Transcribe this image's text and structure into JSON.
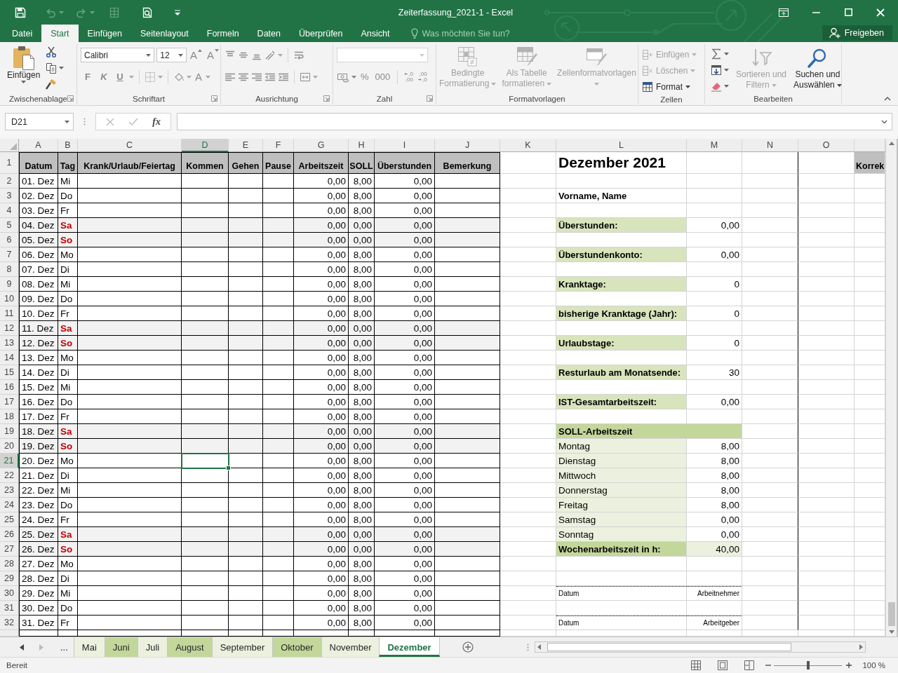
{
  "window": {
    "title": "Zeiterfassung_2021-1 - Excel"
  },
  "ribbon_tabs": [
    {
      "label": "Datei",
      "selected": false
    },
    {
      "label": "Start",
      "selected": true
    },
    {
      "label": "Einfügen",
      "selected": false
    },
    {
      "label": "Seitenlayout",
      "selected": false
    },
    {
      "label": "Formeln",
      "selected": false
    },
    {
      "label": "Daten",
      "selected": false
    },
    {
      "label": "Überprüfen",
      "selected": false
    },
    {
      "label": "Ansicht",
      "selected": false
    }
  ],
  "tell_me": {
    "placeholder": "Was möchten Sie tun?"
  },
  "share_button": "Freigeben",
  "ribbon": {
    "clipboard": {
      "title": "Zwischenablage",
      "paste": "Einfügen"
    },
    "font": {
      "title": "Schriftart",
      "family": "Calibri",
      "size": "12",
      "grow_letter": "A",
      "shrink_letter": "A",
      "bold": "F",
      "italic": "K",
      "underline": "U",
      "color_letter": "A"
    },
    "alignment": {
      "title": "Ausrichtung"
    },
    "number": {
      "title": "Zahl",
      "percent": "%",
      "thousands": "000",
      "increase_decimal": [
        ",0",
        ",00"
      ],
      "decrease_decimal": [
        ",00",
        ",0"
      ]
    },
    "styles": {
      "title": "Formatvorlagen",
      "items": [
        {
          "kind": "conditional",
          "lines": [
            "Bedingte",
            "Formatierung"
          ],
          "disabled": true
        },
        {
          "kind": "table",
          "lines": [
            "Als Tabelle",
            "formatieren"
          ],
          "disabled": true
        },
        {
          "kind": "styles",
          "lines": [
            "Zellenformatvorlagen"
          ],
          "disabled": true
        }
      ]
    },
    "cells": {
      "title": "Zellen",
      "items": [
        {
          "kind": "insert",
          "label": "Einfügen",
          "disabled": true
        },
        {
          "kind": "delete",
          "label": "Löschen",
          "disabled": true
        },
        {
          "kind": "format",
          "label": "Format",
          "disabled": false
        }
      ]
    },
    "editing": {
      "title": "Bearbeiten",
      "items": [
        {
          "kind": "sort",
          "lines": [
            "Sortieren und",
            "Filtern"
          ],
          "disabled": true
        },
        {
          "kind": "find",
          "lines": [
            "Suchen und",
            "Auswählen"
          ],
          "disabled": false
        }
      ]
    }
  },
  "formula_bar": {
    "name_box": "D21",
    "function_label": "fx"
  },
  "sheet": {
    "columns": [
      {
        "label": "A",
        "selected": false
      },
      {
        "label": "B",
        "selected": false
      },
      {
        "label": "C",
        "selected": false
      },
      {
        "label": "D",
        "selected": true
      },
      {
        "label": "E",
        "selected": false
      },
      {
        "label": "F",
        "selected": false
      },
      {
        "label": "G",
        "selected": false
      },
      {
        "label": "H",
        "selected": false
      },
      {
        "label": "I",
        "selected": false
      },
      {
        "label": "J",
        "selected": false
      },
      {
        "label": "K",
        "selected": false
      },
      {
        "label": "L",
        "selected": false
      },
      {
        "label": "M",
        "selected": false
      },
      {
        "label": "N",
        "selected": false
      },
      {
        "label": "O",
        "selected": false
      }
    ],
    "row_numbers": [
      {
        "label": "1",
        "selected": false
      },
      {
        "label": "2",
        "selected": false
      },
      {
        "label": "3",
        "selected": false
      },
      {
        "label": "4",
        "selected": false
      },
      {
        "label": "5",
        "selected": false
      },
      {
        "label": "6",
        "selected": false
      },
      {
        "label": "7",
        "selected": false
      },
      {
        "label": "8",
        "selected": false
      },
      {
        "label": "9",
        "selected": false
      },
      {
        "label": "10",
        "selected": false
      },
      {
        "label": "11",
        "selected": false
      },
      {
        "label": "12",
        "selected": false
      },
      {
        "label": "13",
        "selected": false
      },
      {
        "label": "14",
        "selected": false
      },
      {
        "label": "15",
        "selected": false
      },
      {
        "label": "16",
        "selected": false
      },
      {
        "label": "17",
        "selected": false
      },
      {
        "label": "18",
        "selected": false
      },
      {
        "label": "19",
        "selected": false
      },
      {
        "label": "20",
        "selected": false
      },
      {
        "label": "21",
        "selected": true
      },
      {
        "label": "22",
        "selected": false
      },
      {
        "label": "23",
        "selected": false
      },
      {
        "label": "24",
        "selected": false
      },
      {
        "label": "25",
        "selected": false
      },
      {
        "label": "26",
        "selected": false
      },
      {
        "label": "27",
        "selected": false
      },
      {
        "label": "28",
        "selected": false
      },
      {
        "label": "29",
        "selected": false
      },
      {
        "label": "30",
        "selected": false
      },
      {
        "label": "31",
        "selected": false
      },
      {
        "label": "32",
        "selected": false
      }
    ]
  },
  "table": {
    "columns": [
      "Datum",
      "Tag",
      "Krank/Urlaub/Feiertag",
      "Kommen",
      "Gehen",
      "Pause",
      "Arbeitszeit",
      "SOLL",
      "Überstunden",
      "Bemerkung"
    ],
    "rows": [
      {
        "date": "01. Dez",
        "day": "Mi",
        "weekend": false,
        "work": "0,00",
        "target": "8,00",
        "overtime": "0,00"
      },
      {
        "date": "02. Dez",
        "day": "Do",
        "weekend": false,
        "work": "0,00",
        "target": "8,00",
        "overtime": "0,00"
      },
      {
        "date": "03. Dez",
        "day": "Fr",
        "weekend": false,
        "work": "0,00",
        "target": "8,00",
        "overtime": "0,00"
      },
      {
        "date": "04. Dez",
        "day": "Sa",
        "weekend": true,
        "work": "0,00",
        "target": "0,00",
        "overtime": "0,00"
      },
      {
        "date": "05. Dez",
        "day": "So",
        "weekend": true,
        "work": "0,00",
        "target": "0,00",
        "overtime": "0,00"
      },
      {
        "date": "06. Dez",
        "day": "Mo",
        "weekend": false,
        "work": "0,00",
        "target": "8,00",
        "overtime": "0,00"
      },
      {
        "date": "07. Dez",
        "day": "Di",
        "weekend": false,
        "work": "0,00",
        "target": "8,00",
        "overtime": "0,00"
      },
      {
        "date": "08. Dez",
        "day": "Mi",
        "weekend": false,
        "work": "0,00",
        "target": "8,00",
        "overtime": "0,00"
      },
      {
        "date": "09. Dez",
        "day": "Do",
        "weekend": false,
        "work": "0,00",
        "target": "8,00",
        "overtime": "0,00"
      },
      {
        "date": "10. Dez",
        "day": "Fr",
        "weekend": false,
        "work": "0,00",
        "target": "8,00",
        "overtime": "0,00"
      },
      {
        "date": "11. Dez",
        "day": "Sa",
        "weekend": true,
        "work": "0,00",
        "target": "0,00",
        "overtime": "0,00"
      },
      {
        "date": "12. Dez",
        "day": "So",
        "weekend": true,
        "work": "0,00",
        "target": "0,00",
        "overtime": "0,00"
      },
      {
        "date": "13. Dez",
        "day": "Mo",
        "weekend": false,
        "work": "0,00",
        "target": "8,00",
        "overtime": "0,00"
      },
      {
        "date": "14. Dez",
        "day": "Di",
        "weekend": false,
        "work": "0,00",
        "target": "8,00",
        "overtime": "0,00"
      },
      {
        "date": "15. Dez",
        "day": "Mi",
        "weekend": false,
        "work": "0,00",
        "target": "8,00",
        "overtime": "0,00"
      },
      {
        "date": "16. Dez",
        "day": "Do",
        "weekend": false,
        "work": "0,00",
        "target": "8,00",
        "overtime": "0,00"
      },
      {
        "date": "17. Dez",
        "day": "Fr",
        "weekend": false,
        "work": "0,00",
        "target": "8,00",
        "overtime": "0,00"
      },
      {
        "date": "18. Dez",
        "day": "Sa",
        "weekend": true,
        "work": "0,00",
        "target": "0,00",
        "overtime": "0,00"
      },
      {
        "date": "19. Dez",
        "day": "So",
        "weekend": true,
        "work": "0,00",
        "target": "0,00",
        "overtime": "0,00"
      },
      {
        "date": "20. Dez",
        "day": "Mo",
        "weekend": false,
        "work": "0,00",
        "target": "8,00",
        "overtime": "0,00"
      },
      {
        "date": "21. Dez",
        "day": "Di",
        "weekend": false,
        "work": "0,00",
        "target": "8,00",
        "overtime": "0,00"
      },
      {
        "date": "22. Dez",
        "day": "Mi",
        "weekend": false,
        "work": "0,00",
        "target": "8,00",
        "overtime": "0,00"
      },
      {
        "date": "23. Dez",
        "day": "Do",
        "weekend": false,
        "work": "0,00",
        "target": "8,00",
        "overtime": "0,00"
      },
      {
        "date": "24. Dez",
        "day": "Fr",
        "weekend": false,
        "work": "0,00",
        "target": "8,00",
        "overtime": "0,00"
      },
      {
        "date": "25. Dez",
        "day": "Sa",
        "weekend": true,
        "work": "0,00",
        "target": "0,00",
        "overtime": "0,00"
      },
      {
        "date": "26. Dez",
        "day": "So",
        "weekend": true,
        "work": "0,00",
        "target": "0,00",
        "overtime": "0,00"
      },
      {
        "date": "27. Dez",
        "day": "Mo",
        "weekend": false,
        "work": "0,00",
        "target": "8,00",
        "overtime": "0,00"
      },
      {
        "date": "28. Dez",
        "day": "Di",
        "weekend": false,
        "work": "0,00",
        "target": "8,00",
        "overtime": "0,00"
      },
      {
        "date": "29. Dez",
        "day": "Mi",
        "weekend": false,
        "work": "0,00",
        "target": "8,00",
        "overtime": "0,00"
      },
      {
        "date": "30. Dez",
        "day": "Do",
        "weekend": false,
        "work": "0,00",
        "target": "8,00",
        "overtime": "0,00"
      },
      {
        "date": "31. Dez",
        "day": "Fr",
        "weekend": false,
        "work": "0,00",
        "target": "8,00",
        "overtime": "0,00"
      }
    ]
  },
  "summary": {
    "title": "Dezember 2021",
    "name_label": "Vorname, Name",
    "figures": [
      {
        "label": "Überstunden:",
        "value": "0,00"
      },
      {
        "label": "Überstundenkonto:",
        "value": "0,00"
      },
      {
        "label": "Kranktage:",
        "value": "0"
      },
      {
        "label": "bisherige Kranktage (Jahr):",
        "value": "0"
      },
      {
        "label": "Urlaubstage:",
        "value": "0"
      },
      {
        "label": "Resturlaub am Monatsende:",
        "value": "30"
      },
      {
        "label": "IST-Gesamtarbeitszeit:",
        "value": "0,00"
      }
    ],
    "target_header": "SOLL-Arbeitszeit",
    "target_days": [
      {
        "label": "Montag",
        "value": "8,00"
      },
      {
        "label": "Dienstag",
        "value": "8,00"
      },
      {
        "label": "Mittwoch",
        "value": "8,00"
      },
      {
        "label": "Donnerstag",
        "value": "8,00"
      },
      {
        "label": "Freitag",
        "value": "8,00"
      },
      {
        "label": "Samstag",
        "value": "0,00"
      },
      {
        "label": "Sonntag",
        "value": "0,00"
      }
    ],
    "weekly_total": {
      "label": "Wochenarbeitszeit in h:",
      "value": "40,00"
    },
    "signatures": [
      {
        "date_label": "Datum",
        "role": "Arbeitnehmer"
      },
      {
        "date_label": "Datum",
        "role": "Arbeitgeber"
      }
    ]
  },
  "side_column": {
    "header": "Korrek"
  },
  "sheet_tabs": {
    "more": "...",
    "tabs": [
      {
        "label": "Mai",
        "color": "#ebf1de",
        "selected": false
      },
      {
        "label": "Juni",
        "color": "#c4d79b",
        "selected": false
      },
      {
        "label": "Juli",
        "color": "#ebf1de",
        "selected": false
      },
      {
        "label": "August",
        "color": "#c4d79b",
        "selected": false
      },
      {
        "label": "September",
        "color": "#ebf1de",
        "selected": false
      },
      {
        "label": "Oktober",
        "color": "#c4d79b",
        "selected": false
      },
      {
        "label": "November",
        "color": "#ebf1de",
        "selected": false
      },
      {
        "label": "Dezember",
        "color": "#217346",
        "selected": true
      }
    ]
  },
  "status_bar": {
    "text": "Bereit",
    "zoom": {
      "level": 0.5,
      "reading": "100 %"
    }
  }
}
